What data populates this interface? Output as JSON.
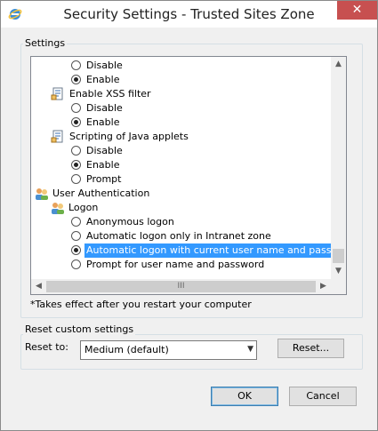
{
  "window": {
    "title": "Security Settings - Trusted Sites Zone",
    "close_glyph": "✕"
  },
  "settings": {
    "group_label": "Settings",
    "rows": [
      {
        "type": "radio",
        "label": "Disable",
        "checked": false
      },
      {
        "type": "radio",
        "label": "Enable",
        "checked": true
      },
      {
        "type": "setting",
        "label": "Enable XSS filter",
        "icon": "settings-page-icon"
      },
      {
        "type": "radio",
        "label": "Disable",
        "checked": false
      },
      {
        "type": "radio",
        "label": "Enable",
        "checked": true
      },
      {
        "type": "setting",
        "label": "Scripting of Java applets",
        "icon": "settings-page-icon"
      },
      {
        "type": "radio",
        "label": "Disable",
        "checked": false
      },
      {
        "type": "radio",
        "label": "Enable",
        "checked": true
      },
      {
        "type": "radio",
        "label": "Prompt",
        "checked": false
      },
      {
        "type": "category",
        "label": "User Authentication",
        "icon": "users-icon"
      },
      {
        "type": "subcategory",
        "label": "Logon",
        "icon": "users-icon"
      },
      {
        "type": "radio",
        "label": "Anonymous logon",
        "checked": false
      },
      {
        "type": "radio",
        "label": "Automatic logon only in Intranet zone",
        "checked": false
      },
      {
        "type": "radio",
        "label": "Automatic logon with current user name and password",
        "checked": true,
        "selected": true
      },
      {
        "type": "radio",
        "label": "Prompt for user name and password",
        "checked": false
      }
    ],
    "scroll_grip": "III",
    "note": "*Takes effect after you restart your computer"
  },
  "reset": {
    "group_label": "Reset custom settings",
    "reset_to_label": "Reset to:",
    "selected_level": "Medium (default)",
    "reset_button": "Reset..."
  },
  "footer": {
    "ok_button": "OK",
    "cancel_button": "Cancel"
  },
  "colors": {
    "selection": "#3399ff",
    "close_button": "#c75050"
  }
}
